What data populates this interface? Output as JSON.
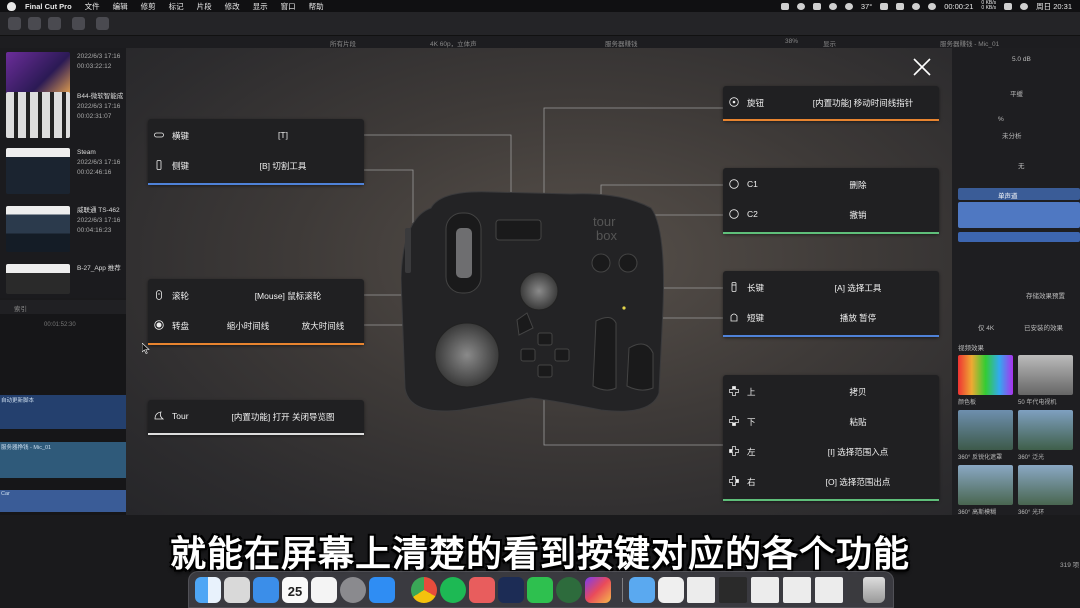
{
  "menubar": {
    "app_name": "Final Cut Pro",
    "menus": [
      "文件",
      "编辑",
      "修剪",
      "标记",
      "片段",
      "修改",
      "显示",
      "窗口",
      "帮助"
    ],
    "temperature": "37°",
    "timer": "00:00:21",
    "net_up": "0 KB/s",
    "net_down": "0 KB/s",
    "date": "周日 20:31"
  },
  "fcp": {
    "browser_filter": "所有片段",
    "format": "4K 60p，立体声",
    "project_name": "服务器赚钱",
    "zoom": "38%",
    "view_label": "显示",
    "inspector_title": "服务器赚钱 - Mic_01",
    "clips": [
      {
        "title": "",
        "date": "2022/6/3 17:16",
        "duration": "00:03:22:12"
      },
      {
        "title": "B44-微软智能成 ver2.0",
        "date": "2022/6/3 17:16",
        "duration": "00:02:31:07"
      },
      {
        "title": "Steam",
        "date": "2022/6/3 17:16",
        "duration": "00:02:46:16"
      },
      {
        "title": "威联通 TS-462",
        "date": "2022/6/3 17:16",
        "duration": "00:04:16:23"
      },
      {
        "title": "B-27_App 推荐",
        "date": "",
        "duration": ""
      }
    ],
    "timeline_index": "索引",
    "timeline_timecode": "00:01:52:30",
    "tracks": [
      "自动更新脚本",
      "服务器挣钱 - Mic_01",
      "Car"
    ],
    "inspector": {
      "volume": "5.0 dB",
      "pan": "平缓",
      "percent": "%",
      "analysis": "未分析",
      "none": "无",
      "channel": "单声道",
      "save_preset": "存储效果预置",
      "filter_4k": "仅 4K",
      "installed": "已安装的效果",
      "category": "视频效果",
      "effects": [
        "颜色板",
        "50 年代电视机",
        "360° 反锐化遮罩",
        "360° 泛光",
        "360° 高斯模糊",
        "360° 光环"
      ],
      "count": "319 项"
    }
  },
  "overlay": {
    "close_label": "×",
    "device_brand": "tour box",
    "left_cards": [
      {
        "rows": [
          {
            "icon": "horizontal-key-icon",
            "name": "横键",
            "value": "[T]"
          },
          {
            "icon": "side-key-icon",
            "name": "侧键",
            "value": "[B] 切割工具"
          }
        ],
        "accent": "#4f82d8"
      },
      {
        "rows": [
          {
            "icon": "scroll-wheel-icon",
            "name": "滚轮",
            "value": "[Mouse] 鼠标滚轮"
          },
          {
            "icon": "dial-icon",
            "name": "转盘",
            "value_a": "缩小时间线",
            "value_b": "放大时间线"
          }
        ],
        "accent": "#e8842f"
      },
      {
        "rows": [
          {
            "icon": "tour-icon",
            "name": "Tour",
            "value": "[内置功能] 打开 关闭导览图"
          }
        ],
        "accent": "#dddddd"
      }
    ],
    "right_cards": [
      {
        "rows": [
          {
            "icon": "knob-icon",
            "name": "旋钮",
            "value": "[内置功能] 移动时间线指针"
          }
        ],
        "accent": "#e8842f"
      },
      {
        "rows": [
          {
            "icon": "c1-icon",
            "name": "C1",
            "value": "删除"
          },
          {
            "icon": "c2-icon",
            "name": "C2",
            "value": "撤销"
          }
        ],
        "accent": "#5fbf7a"
      },
      {
        "rows": [
          {
            "icon": "long-key-icon",
            "name": "长键",
            "value": "[A] 选择工具"
          },
          {
            "icon": "short-key-icon",
            "name": "短键",
            "value": "播放 暂停"
          }
        ],
        "accent": "#4f82d8"
      },
      {
        "rows": [
          {
            "icon": "dpad-up-icon",
            "name": "上",
            "value": "拷贝"
          },
          {
            "icon": "dpad-down-icon",
            "name": "下",
            "value": "粘贴"
          },
          {
            "icon": "dpad-left-icon",
            "name": "左",
            "value": "[I] 选择范围入点"
          },
          {
            "icon": "dpad-right-icon",
            "name": "右",
            "value": "[O] 选择范围出点"
          }
        ],
        "accent": "#5fbf7a"
      }
    ]
  },
  "subtitle": "就能在屏幕上清楚的看到按键对应的各个功能",
  "dock": {
    "calendar_day": "25",
    "apps": [
      "finder",
      "launchpad",
      "mail",
      "calendar",
      "reminders",
      "system-preferences",
      "app-store",
      "chrome",
      "spotify",
      "paw",
      "quicktime",
      "wechat",
      "mindnode",
      "final-cut-pro",
      "folder",
      "preview",
      "window-1",
      "window-2",
      "window-3",
      "window-4",
      "trash"
    ]
  }
}
